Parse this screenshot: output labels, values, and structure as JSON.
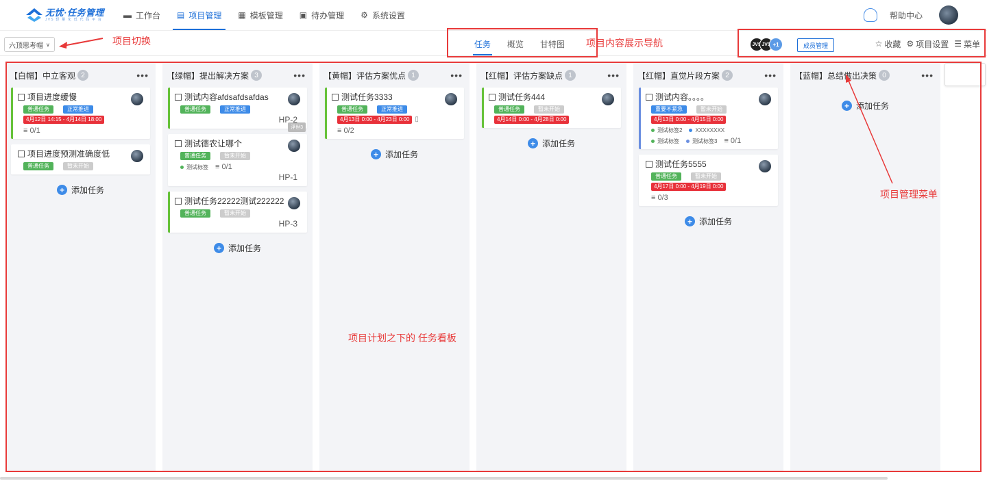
{
  "logo": {
    "main": "无忧·任务管理",
    "sub": "JVS 轻 量 化 低 代 码 平 台"
  },
  "nav": [
    {
      "label": "工作台",
      "icon": "monitor-icon"
    },
    {
      "label": "项目管理",
      "icon": "document-icon",
      "active": true
    },
    {
      "label": "模板管理",
      "icon": "grid-icon"
    },
    {
      "label": "待办管理",
      "icon": "calendar-icon"
    },
    {
      "label": "系统设置",
      "icon": "gear-icon"
    }
  ],
  "header": {
    "help": "帮助中心"
  },
  "project_switch": {
    "label": "六顶思考帽"
  },
  "tabs": [
    "任务",
    "概览",
    "甘特图"
  ],
  "members": {
    "avatars": [
      "JVS",
      "JVS"
    ],
    "more": "+1",
    "manage_label": "成员管理"
  },
  "actions": {
    "favorite": "收藏",
    "settings": "项目设置",
    "menu": "菜单"
  },
  "columns": [
    {
      "title": "【白帽】中立客观",
      "count": "2",
      "cards": [
        {
          "title": "项目进度缓慢",
          "border": "green",
          "tags": [
            {
              "text": "普通任务",
              "color": "green"
            },
            {
              "text": "正常推进",
              "color": "blue"
            },
            {
              "text": "4月12日 14:15 - 4月14日 18:00",
              "color": "date"
            }
          ],
          "meta": [
            "≡ 0/1"
          ]
        },
        {
          "title": "项目进度预测准确度低",
          "border": "none",
          "tags": [
            {
              "text": "普通任务",
              "color": "green"
            },
            {
              "text": "暂未开始",
              "color": "gray"
            }
          ]
        }
      ],
      "add": "添加任务"
    },
    {
      "title": "【绿帽】提出解决方案",
      "count": "3",
      "cards": [
        {
          "title": "测试内容afdsafdsafdas",
          "border": "green",
          "tags": [
            {
              "text": "普通任务",
              "color": "green"
            },
            {
              "text": "正常推进",
              "color": "blue"
            }
          ],
          "code": "HP-2"
        },
        {
          "title": "测试德农让哪个",
          "border": "none",
          "tags": [
            {
              "text": "普通任务",
              "color": "green"
            },
            {
              "text": "暂未开始",
              "color": "gray"
            }
          ],
          "labels": [
            {
              "text": "测试标签",
              "dot": "#52b35a"
            }
          ],
          "meta": [
            "≡ 0/1"
          ],
          "code": "HP-1",
          "tooltip": "浮世3"
        },
        {
          "title": "测试任务22222测试222222",
          "border": "green",
          "tags": [
            {
              "text": "普通任务",
              "color": "green"
            },
            {
              "text": "暂未开始",
              "color": "gray"
            }
          ],
          "code": "HP-3"
        }
      ],
      "add": "添加任务"
    },
    {
      "title": "【黄帽】评估方案优点",
      "count": "1",
      "cards": [
        {
          "title": "测试任务3333",
          "border": "green",
          "tags": [
            {
              "text": "普通任务",
              "color": "green"
            },
            {
              "text": "正常推进",
              "color": "blue"
            },
            {
              "text": "4月13日 0:00 - 4月23日 0:00",
              "color": "date"
            }
          ],
          "meta": [
            "≡ 0/2"
          ]
        }
      ],
      "add": "添加任务"
    },
    {
      "title": "【红帽】评估方案缺点",
      "count": "1",
      "cards": [
        {
          "title": "测试任务444",
          "border": "green",
          "tags": [
            {
              "text": "普通任务",
              "color": "green"
            },
            {
              "text": "暂未开始",
              "color": "gray"
            },
            {
              "text": "4月14日 0:00 - 4月28日 0:00",
              "color": "date"
            }
          ]
        }
      ],
      "add": "添加任务"
    },
    {
      "title": "【红帽】直觉片段方案",
      "count": "2",
      "cards": [
        {
          "title": "测试内容。。。。",
          "border": "blue",
          "tags": [
            {
              "text": "重要不紧急",
              "color": "blue"
            },
            {
              "text": "暂未开始",
              "color": "gray"
            },
            {
              "text": "4月13日 0:00 - 4月15日 0:00",
              "color": "date"
            }
          ],
          "labels": [
            {
              "text": "测试标签2",
              "dot": "#52b35a"
            },
            {
              "text": "XXXXXXXX",
              "dot": "#3d8be8"
            },
            {
              "text": "测试标签",
              "dot": "#52b35a"
            },
            {
              "text": "测试标签3",
              "dot": "#6b8fe0"
            }
          ],
          "meta": [
            "≡ 0/1"
          ]
        },
        {
          "title": "测试任务5555",
          "border": "none",
          "tags": [
            {
              "text": "普通任务",
              "color": "green"
            },
            {
              "text": "暂未开始",
              "color": "gray"
            },
            {
              "text": "4月17日 0:00 - 4月19日 0:00",
              "color": "date"
            }
          ],
          "meta": [
            "≡ 0/3"
          ]
        }
      ],
      "add": "添加任务"
    },
    {
      "title": "【蓝帽】总结做出决策",
      "count": "0",
      "cards": [],
      "add": "添加任务"
    }
  ],
  "annotations": {
    "project_switch": "项目切换",
    "content_nav": "项目内容展示导航",
    "board": "项目计划之下的 任务看板",
    "menu": "项目管理菜单"
  },
  "colors": {
    "accent": "#1d6fd8",
    "annotation": "#e83a3a",
    "green": "#52b35a",
    "blue": "#3d8be8",
    "date": "#e8313a"
  }
}
